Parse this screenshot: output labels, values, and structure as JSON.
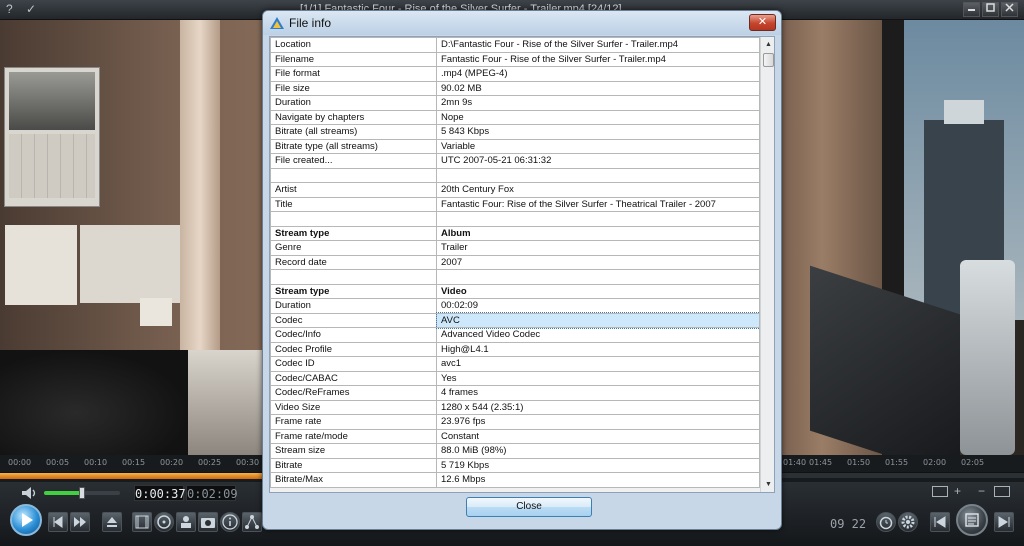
{
  "titlebar": {
    "help": "?",
    "pin": "✓",
    "title": "[1/1] Fantastic Four - Rise of the Silver Surfer - Trailer.mp4 [24/12]"
  },
  "timeline": {
    "ticks_left": [
      "00:00",
      "00:05",
      "00:10",
      "00:15",
      "00:20",
      "00:25",
      "00:30"
    ],
    "ticks_right": [
      "01:40",
      "01:45",
      "01:50",
      "01:55",
      "02:00",
      "02:05"
    ],
    "progress": 0.285
  },
  "controls": {
    "current_time": "0:00:37",
    "total_time": "0:02:09",
    "volume": 0.5,
    "clock": "09 22",
    "zoom_minus": "−",
    "zoom_plus": "+"
  },
  "dialog": {
    "title": "File info",
    "close_x": "✕",
    "close_button": "Close",
    "rows": [
      {
        "key": "Location",
        "value": "D:\\Fantastic Four - Rise of the Silver Surfer - Trailer.mp4"
      },
      {
        "key": "Filename",
        "value": "Fantastic Four - Rise of the Silver Surfer - Trailer.mp4"
      },
      {
        "key": "File format",
        "value": ".mp4 (MPEG-4)"
      },
      {
        "key": "File size",
        "value": "90.02 MB"
      },
      {
        "key": "Duration",
        "value": "2mn 9s"
      },
      {
        "key": "Navigate by chapters",
        "value": "Nope"
      },
      {
        "key": "Bitrate (all streams)",
        "value": "5 843 Kbps"
      },
      {
        "key": "Bitrate type (all streams)",
        "value": "Variable"
      },
      {
        "key": "File created...",
        "value": "UTC 2007-05-21 06:31:32"
      },
      {
        "key": "",
        "value": ""
      },
      {
        "key": "Artist",
        "value": "20th Century Fox"
      },
      {
        "key": "Title",
        "value": "Fantastic Four: Rise of the Silver Surfer - Theatrical Trailer - 2007"
      },
      {
        "key": "",
        "value": ""
      },
      {
        "key": "Stream type",
        "value": "Album",
        "bold": true
      },
      {
        "key": "Genre",
        "value": "Trailer"
      },
      {
        "key": "Record date",
        "value": "2007"
      },
      {
        "key": "",
        "value": ""
      },
      {
        "key": "Stream type",
        "value": "Video",
        "bold": true
      },
      {
        "key": "Duration",
        "value": "00:02:09"
      },
      {
        "key": "Codec",
        "value": "AVC",
        "selected": true
      },
      {
        "key": "Codec/Info",
        "value": "Advanced Video Codec"
      },
      {
        "key": "Codec Profile",
        "value": "High@L4.1"
      },
      {
        "key": "Codec ID",
        "value": "avc1"
      },
      {
        "key": "Codec/CABAC",
        "value": "Yes"
      },
      {
        "key": "Codec/ReFrames",
        "value": "4 frames"
      },
      {
        "key": "Video Size",
        "value": "1280 x 544 (2.35:1)"
      },
      {
        "key": "Frame rate",
        "value": "23.976 fps"
      },
      {
        "key": "Frame rate/mode",
        "value": "Constant"
      },
      {
        "key": "Stream size",
        "value": "88.0 MiB (98%)"
      },
      {
        "key": "Bitrate",
        "value": "5 719 Kbps"
      },
      {
        "key": "Bitrate/Max",
        "value": "12.6 Mbps"
      }
    ]
  }
}
